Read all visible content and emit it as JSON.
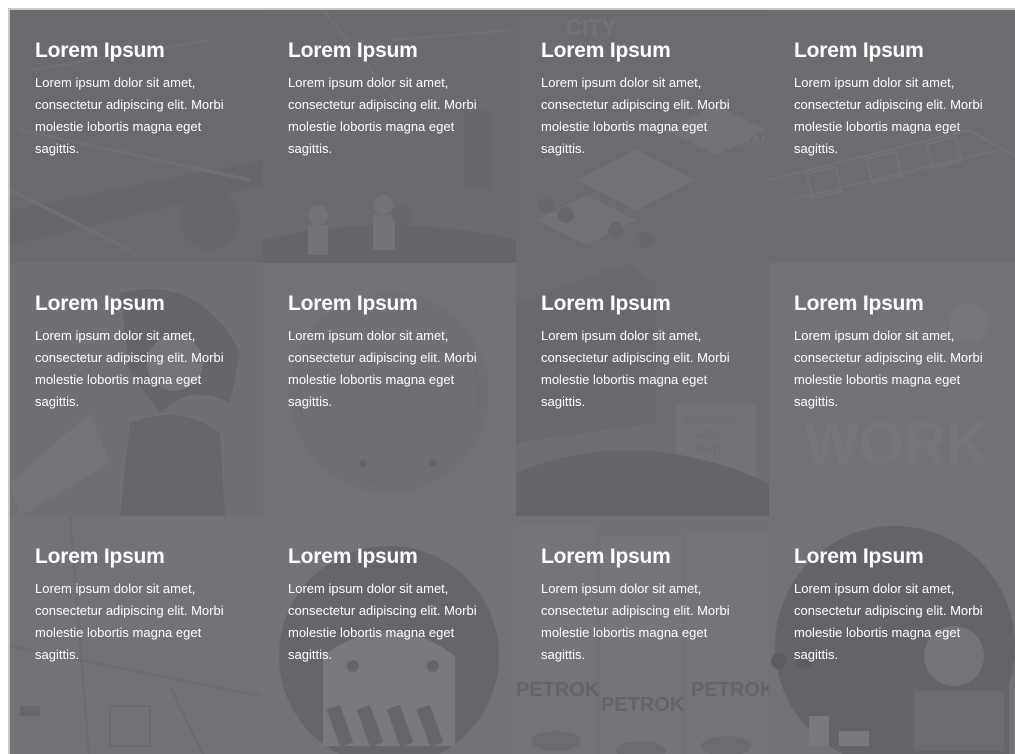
{
  "tiles": [
    {
      "title": "Lorem Ipsum",
      "body": "Lorem ipsum dolor sit amet, consectetur adipiscing elit. Morbi molestie lobortis magna eget sagittis."
    },
    {
      "title": "Lorem Ipsum",
      "body": "Lorem ipsum dolor sit amet, consectetur adipiscing elit. Morbi molestie lobortis magna eget sagittis."
    },
    {
      "title": "Lorem Ipsum",
      "body": "Lorem ipsum dolor sit amet, consectetur adipiscing elit. Morbi molestie lobortis magna eget sagittis."
    },
    {
      "title": "Lorem Ipsum",
      "body": "Lorem ipsum dolor sit amet, consectetur adipiscing elit. Morbi molestie lobortis magna eget sagittis."
    },
    {
      "title": "Lorem Ipsum",
      "body": "Lorem ipsum dolor sit amet, consectetur adipiscing elit. Morbi molestie lobortis magna eget sagittis."
    },
    {
      "title": "Lorem Ipsum",
      "body": "Lorem ipsum dolor sit amet, consectetur adipiscing elit. Morbi molestie lobortis magna eget sagittis."
    },
    {
      "title": "Lorem Ipsum",
      "body": "Lorem ipsum dolor sit amet, consectetur adipiscing elit. Morbi molestie lobortis magna eget sagittis."
    },
    {
      "title": "Lorem Ipsum",
      "body": "Lorem ipsum dolor sit amet, consectetur adipiscing elit. Morbi molestie lobortis magna eget sagittis."
    },
    {
      "title": "Lorem Ipsum",
      "body": "Lorem ipsum dolor sit amet, consectetur adipiscing elit. Morbi molestie lobortis magna eget sagittis."
    },
    {
      "title": "Lorem Ipsum",
      "body": "Lorem ipsum dolor sit amet, consectetur adipiscing elit. Morbi molestie lobortis magna eget sagittis."
    },
    {
      "title": "Lorem Ipsum",
      "body": "Lorem ipsum dolor sit amet, consectetur adipiscing elit. Morbi molestie lobortis magna eget sagittis."
    },
    {
      "title": "Lorem Ipsum",
      "body": "Lorem ipsum dolor sit amet, consectetur adipiscing elit. Morbi molestie lobortis magna eget sagittis."
    }
  ],
  "background_art": {
    "tile_0": {
      "subject": "sketch"
    },
    "tile_1": {
      "subject": "boat-people-illustration"
    },
    "tile_2": {
      "subject": "city-poster-isometric",
      "lettering": [
        "CITY",
        "BRAND"
      ]
    },
    "tile_3": {
      "subject": "wireframe-sketch"
    },
    "tile_4": {
      "subject": "anime-girl-illustration"
    },
    "tile_5": {
      "subject": "circle-poster"
    },
    "tile_6": {
      "subject": "street-scene-illustration",
      "lettering": [
        "MERDEKA",
        "ATAU",
        "MATI"
      ]
    },
    "tile_7": {
      "subject": "work-lettering",
      "lettering": [
        "WORK"
      ]
    },
    "tile_8": {
      "subject": "packaging-dieline-sketch"
    },
    "tile_9": {
      "subject": "mascot-circle-illustration"
    },
    "tile_10": {
      "subject": "product-packaging",
      "lettering": [
        "PETROK",
        "PETROK",
        "PETROK"
      ]
    },
    "tile_11": {
      "subject": "desk-character-illustration"
    }
  }
}
